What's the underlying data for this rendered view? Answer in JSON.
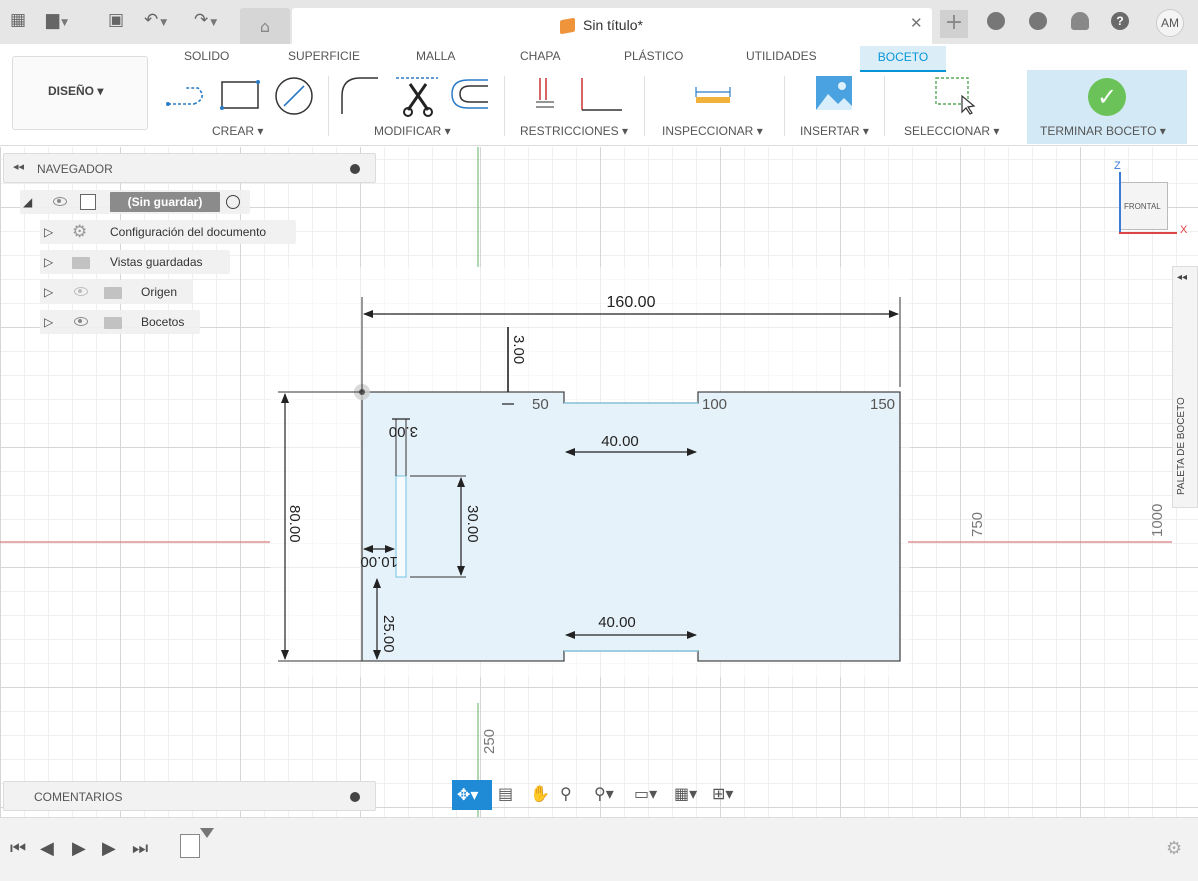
{
  "title_bar": {
    "document_title": "Sin título*",
    "user_initials": "AM",
    "icons": [
      "apps-grid-icon",
      "file-icon",
      "save-icon",
      "undo-icon",
      "redo-icon",
      "home-icon",
      "close-icon",
      "plus-icon",
      "extensions-icon",
      "job-status-icon",
      "notifications-icon",
      "help-icon"
    ]
  },
  "workspace_tabs": [
    {
      "label": "SOLIDO",
      "active": false
    },
    {
      "label": "SUPERFICIE",
      "active": false
    },
    {
      "label": "MALLA",
      "active": false
    },
    {
      "label": "CHAPA",
      "active": false
    },
    {
      "label": "PLÁSTICO",
      "active": false
    },
    {
      "label": "UTILIDADES",
      "active": false
    },
    {
      "label": "BOCETO",
      "active": true
    }
  ],
  "toolbar": {
    "design_label": "DISEÑO",
    "groups": {
      "create": "CREAR",
      "modify": "MODIFICAR",
      "constraints": "RESTRICCIONES",
      "inspect": "INSPECCIONAR",
      "insert": "INSERTAR",
      "select": "SELECCIONAR",
      "finish": "TERMINAR BOCETO"
    },
    "accent_color": "#0696d7",
    "finish_color": "#6ac259"
  },
  "navigator": {
    "title": "NAVEGADOR",
    "root": "(Sin guardar)",
    "items": [
      {
        "label": "Configuración del documento",
        "icon": "gear-icon"
      },
      {
        "label": "Vistas guardadas",
        "icon": "folder-icon"
      },
      {
        "label": "Origen",
        "icon": "folder-icon",
        "visible": false
      },
      {
        "label": "Bocetos",
        "icon": "folder-icon",
        "visible": true
      }
    ]
  },
  "sketch": {
    "dimensions": {
      "overall_width": "160.00",
      "top_offset": "3.00",
      "top_notch_width": "40.00",
      "bottom_notch_width": "40.00",
      "height": "80.00",
      "slot_width": "3.00",
      "slot_height": "30.00",
      "slot_left_offset": "10.00",
      "slot_bottom_offset": "25.00"
    },
    "ruler_labels": {
      "x50": "50",
      "x100": "100",
      "x150": "150",
      "x250": "250",
      "x750": "750",
      "x1000": "1000"
    },
    "profile_fill": "#e6f2f9",
    "axis_x_color": "#d97a7a",
    "axis_y_color": "#7bbf7b"
  },
  "viewcube": {
    "face": "FRONTAL",
    "z": "Z",
    "x": "X"
  },
  "sketch_palette": {
    "label": "PALETA DE BOCETO"
  },
  "comments": {
    "label": "COMENTARIOS"
  },
  "timeline": {
    "icons": [
      "skip-start-icon",
      "step-back-icon",
      "play-icon",
      "step-forward-icon",
      "skip-end-icon",
      "sketch-feature-icon",
      "settings-icon"
    ]
  }
}
